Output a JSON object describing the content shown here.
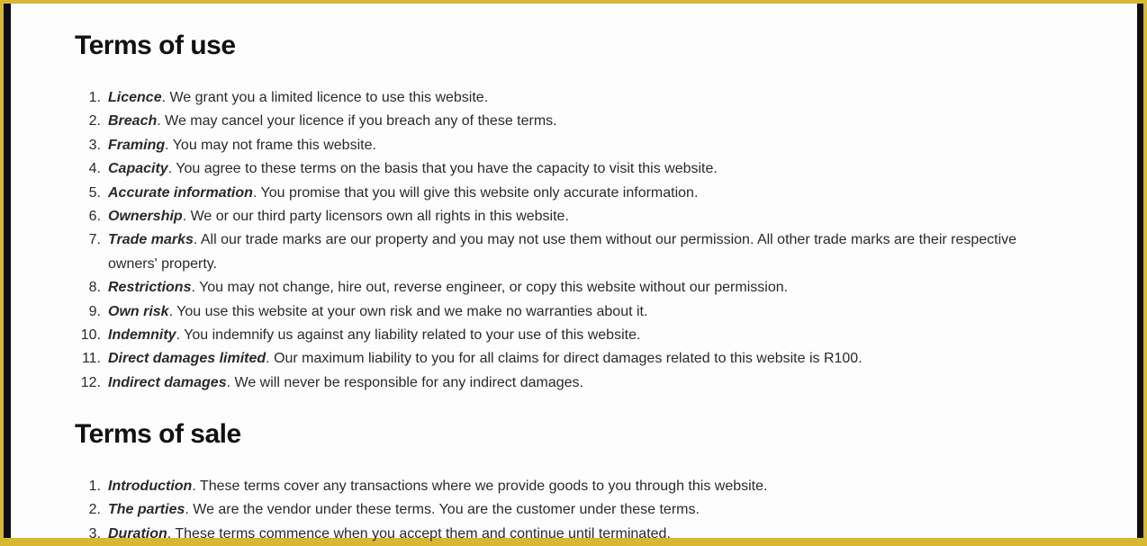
{
  "sections": [
    {
      "title": "Terms of use",
      "items": [
        {
          "num": "1.",
          "term": "Licence",
          "text": ". We grant you a limited licence to use this website."
        },
        {
          "num": "2.",
          "term": "Breach",
          "text": ". We may cancel your licence if you breach any of these terms."
        },
        {
          "num": "3.",
          "term": "Framing",
          "text": ". You may not frame this website."
        },
        {
          "num": "4.",
          "term": "Capacity",
          "text": ". You agree to these terms on the basis that you have the capacity to visit this website."
        },
        {
          "num": "5.",
          "term": "Accurate information",
          "text": ". You promise that you will give this website only accurate information."
        },
        {
          "num": "6.",
          "term": "Ownership",
          "text": ". We or our third party licensors own all rights in this website."
        },
        {
          "num": "7.",
          "term": "Trade marks",
          "text": ". All our trade marks are our property and you may not use them without our permission. All other trade marks are their respective owners' property."
        },
        {
          "num": "8.",
          "term": "Restrictions",
          "text": ". You may not change, hire out, reverse engineer, or copy this website without our permission."
        },
        {
          "num": "9.",
          "term": "Own risk",
          "text": ". You use this website at your own risk and we make no warranties about it."
        },
        {
          "num": "10.",
          "term": "Indemnity",
          "text": ". You indemnify us against any liability related to your use of this website."
        },
        {
          "num": "11.",
          "term": "Direct damages limited",
          "text": ". Our maximum liability to you for all claims for direct damages related to this website is R100."
        },
        {
          "num": "12.",
          "term": "Indirect damages",
          "text": ". We will never be responsible for any indirect damages."
        }
      ]
    },
    {
      "title": "Terms of sale",
      "items": [
        {
          "num": "1.",
          "term": "Introduction",
          "text": ". These terms cover any transactions where we provide goods to you through this website."
        },
        {
          "num": "2.",
          "term": "The parties",
          "text": ". We are the vendor under these terms. You are the customer under these terms."
        },
        {
          "num": "3.",
          "term": "Duration",
          "text": ". These terms commence when you accept them and continue until terminated."
        }
      ]
    }
  ]
}
